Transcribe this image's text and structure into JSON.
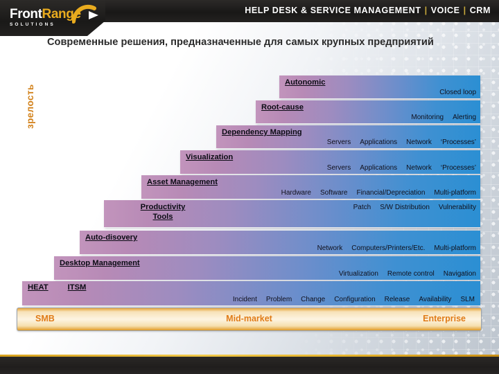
{
  "header": {
    "logo": {
      "word_front": "Front",
      "word_range": "Range",
      "subtitle": "SOLUTIONS",
      "arc_icon": "arc-arrow-icon"
    },
    "tagline_1": "HELP DESK & SERVICE MANAGEMENT",
    "tagline_sep_1": "|",
    "tagline_2": "VOICE",
    "tagline_sep_2": "|",
    "tagline_3": "CRM"
  },
  "slide": {
    "title": "Современные решения, предназначенные для самых крупных предприятий",
    "axis_label": "зрелость"
  },
  "chart_data": {
    "type": "bar",
    "title": "Современные решения, предназначенные для самых крупных предприятий",
    "ylabel": "зрелость",
    "xlabel": "",
    "grid": false,
    "legend": "none",
    "orientation": "horizontal-stacked-pyramid",
    "colors": {
      "bar_gradient_start": "#c294bc",
      "bar_gradient_end": "#2b8fd3",
      "accent_orange": "#e07b16",
      "axis_label_color": "#d2811a",
      "brand_gold": "#e9ab1e",
      "header_dark": "#1a1918"
    },
    "categories": [
      "Autonomic",
      "Root-cause",
      "Dependency Mapping",
      "Visualization",
      "Asset Management",
      "Productivity\nTools",
      "Auto-disovery",
      "Desktop Management",
      "ITSM"
    ],
    "values": [
      290,
      324,
      381,
      433,
      489,
      543,
      578,
      615,
      661
    ],
    "xlim": [
      0,
      693
    ],
    "ylim": [
      0,
      9
    ],
    "market_segments": [
      "SMB",
      "Mid-market",
      "Enterprise"
    ]
  },
  "bars": [
    {
      "title": "Autonomic",
      "items": [
        "Closed loop"
      ]
    },
    {
      "title": "Root-cause",
      "items": [
        "Monitoring",
        "Alerting"
      ]
    },
    {
      "title": "Dependency Mapping",
      "items": [
        "Servers",
        "Applications",
        "Network",
        "‘Processes’"
      ]
    },
    {
      "title": "Visualization",
      "items": [
        "Servers",
        "Applications",
        "Network",
        "‘Processes’"
      ]
    },
    {
      "title": "Asset Management",
      "items": [
        "Hardware",
        "Software",
        "Financial/Depreciation",
        "Multi-platform"
      ]
    },
    {
      "title": "Productivity\nTools",
      "items": [
        "Patch",
        "S/W Distribution",
        "Vulnerability"
      ]
    },
    {
      "title": "Auto-disovery",
      "items": [
        "Network",
        "Computers/Printers/Etc.",
        "Multi-platform"
      ]
    },
    {
      "title": "Desktop Management",
      "items": [
        "Virtualization",
        "Remote control",
        "Navigation"
      ]
    },
    {
      "title": "ITSM",
      "left_label_1": "HEAT",
      "left_label_2": "ITSM",
      "items": [
        "Incident",
        "Problem",
        "Change",
        "Configuration",
        "Release",
        "Availability",
        "SLM"
      ]
    }
  ],
  "market": {
    "smb": "SMB",
    "mid": "Mid-market",
    "enterprise": "Enterprise"
  }
}
